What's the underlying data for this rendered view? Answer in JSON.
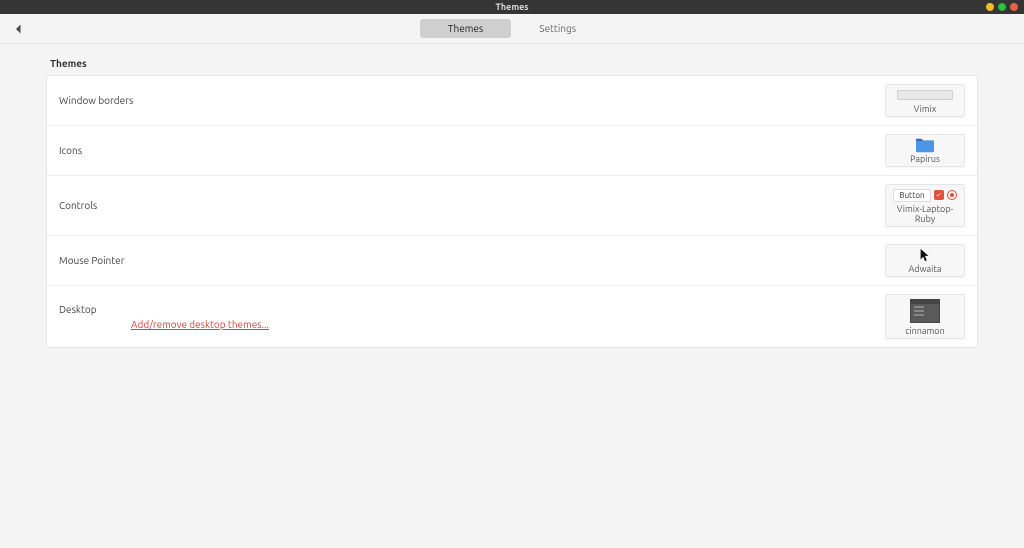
{
  "window": {
    "title": "Themes"
  },
  "tabs": {
    "themes": "Themes",
    "settings": "Settings"
  },
  "section": {
    "heading": "Themes"
  },
  "rows": {
    "window_borders": {
      "label": "Window borders",
      "value": "Vimix"
    },
    "icons": {
      "label": "Icons",
      "value": "Papirus"
    },
    "controls": {
      "label": "Controls",
      "value": "Vimix-Laptop-Ruby",
      "mini_button_label": "Button"
    },
    "mouse_pointer": {
      "label": "Mouse Pointer",
      "value": "Adwaita"
    },
    "desktop": {
      "label": "Desktop",
      "value": "cinnamon",
      "link": "Add/remove desktop themes..."
    }
  },
  "colors": {
    "accent": "#e2523a",
    "folder": "#3a86d8"
  }
}
